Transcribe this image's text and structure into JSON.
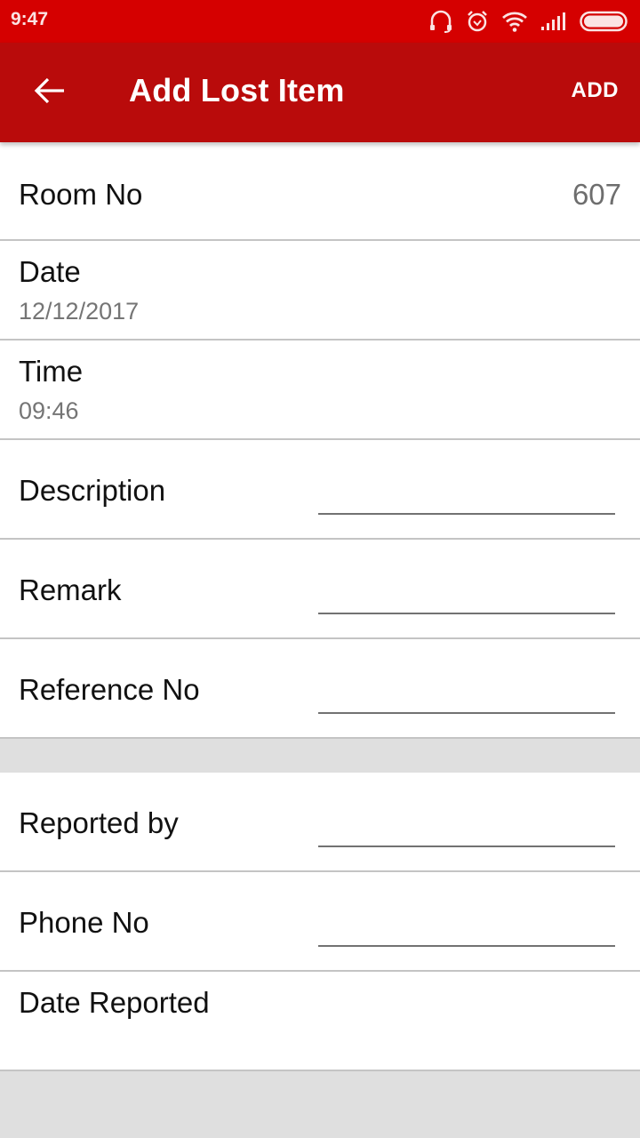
{
  "status_bar": {
    "time": "9:47",
    "icons": [
      "headset-icon",
      "alarm-icon",
      "wifi-icon",
      "signal-icon",
      "battery-icon"
    ]
  },
  "app_bar": {
    "title": "Add Lost Item",
    "back_icon": "arrow-left-icon",
    "action_label": "ADD"
  },
  "colors": {
    "status_bar": "#d50000",
    "app_bar": "#b90b0b",
    "divider": "#c4c4c4",
    "section_gap": "#dfdfdf"
  },
  "form": {
    "room_no": {
      "label": "Room No",
      "value": "607"
    },
    "date": {
      "label": "Date",
      "value": "12/12/2017"
    },
    "time": {
      "label": "Time",
      "value": "09:46"
    },
    "description": {
      "label": "Description",
      "value": "",
      "placeholder": ""
    },
    "remark": {
      "label": "Remark",
      "value": "",
      "placeholder": ""
    },
    "reference_no": {
      "label": "Reference No",
      "value": "",
      "placeholder": ""
    },
    "reported_by": {
      "label": "Reported by",
      "value": "",
      "placeholder": ""
    },
    "phone_no": {
      "label": "Phone No",
      "value": "",
      "placeholder": ""
    },
    "date_reported": {
      "label": "Date Reported",
      "value": ""
    }
  }
}
